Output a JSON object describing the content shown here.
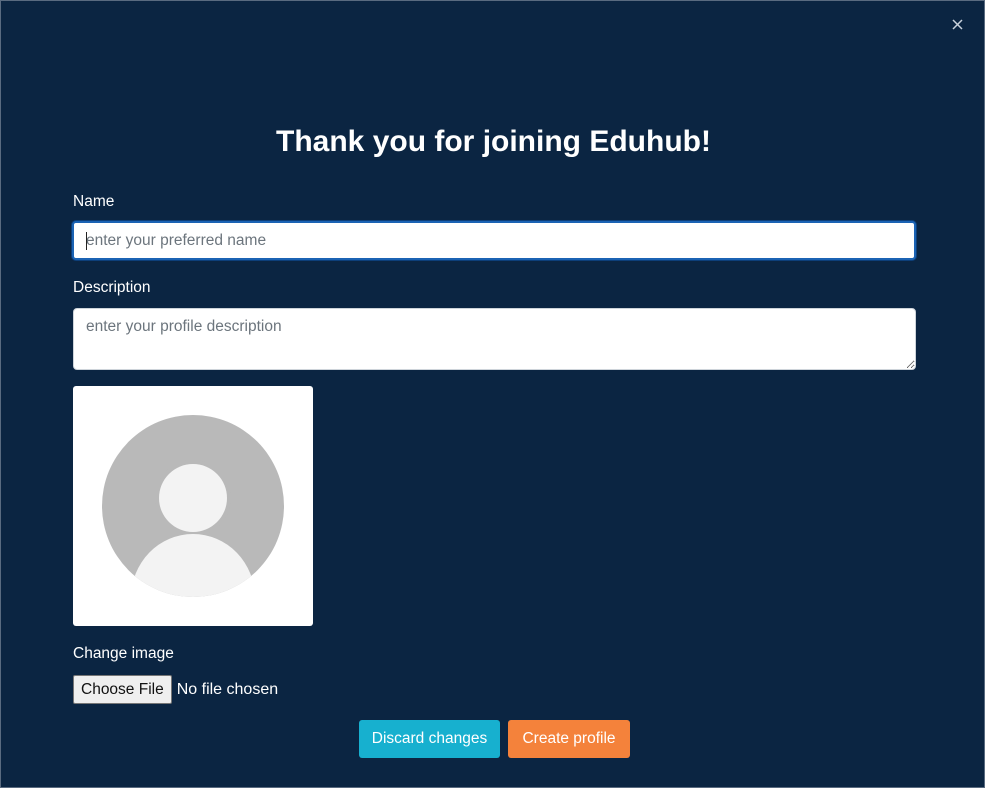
{
  "modal": {
    "close_label": "×",
    "title": "Thank you for joining Eduhub!"
  },
  "form": {
    "name": {
      "label": "Name",
      "value": "",
      "placeholder": "enter your preferred name"
    },
    "description": {
      "label": "Description",
      "value": "",
      "placeholder": "enter your profile description"
    },
    "avatar": {
      "icon": "default-user-avatar-icon"
    },
    "image": {
      "label": "Change image",
      "button_label": "Choose File",
      "status": "No file chosen"
    }
  },
  "actions": {
    "discard_label": "Discard changes",
    "create_label": "Create profile"
  },
  "colors": {
    "background": "#0b2542",
    "discard": "#17b0cf",
    "create": "#f4823b",
    "focus_border": "#1b63b4"
  }
}
